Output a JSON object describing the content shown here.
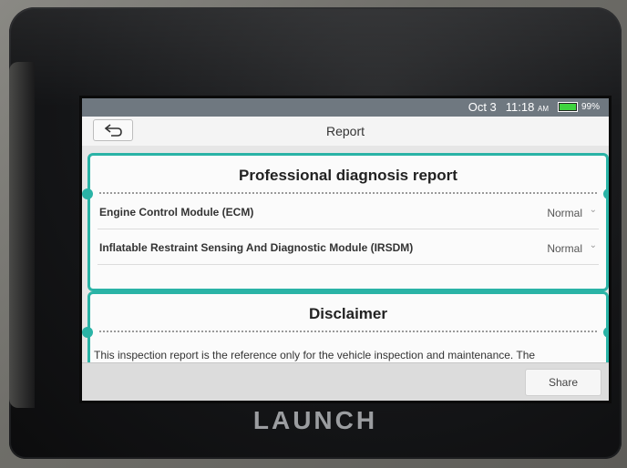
{
  "status_bar": {
    "date": "Oct 3",
    "time": "11:18",
    "ampm": "AM",
    "battery": "99%",
    "battery_level": 0.99
  },
  "title_bar": {
    "title": "Report",
    "back_icon": "back-arrow-icon"
  },
  "report_card": {
    "title": "Professional diagnosis report",
    "rows": [
      {
        "label": "Engine Control Module (ECM)",
        "status": "Normal"
      },
      {
        "label": "Inflatable Restraint Sensing And Diagnostic Module (IRSDM)",
        "status": "Normal"
      }
    ]
  },
  "disclaimer_card": {
    "title": "Disclaimer",
    "text": "This inspection report is the reference only for the vehicle inspection and maintenance. The"
  },
  "bottom_bar": {
    "share_label": "Share"
  },
  "device": {
    "brand": "LAUNCH"
  },
  "colors": {
    "accent": "#2ab3a6",
    "status_bar": "#6f7880",
    "battery_fill": "#3fd43f"
  }
}
